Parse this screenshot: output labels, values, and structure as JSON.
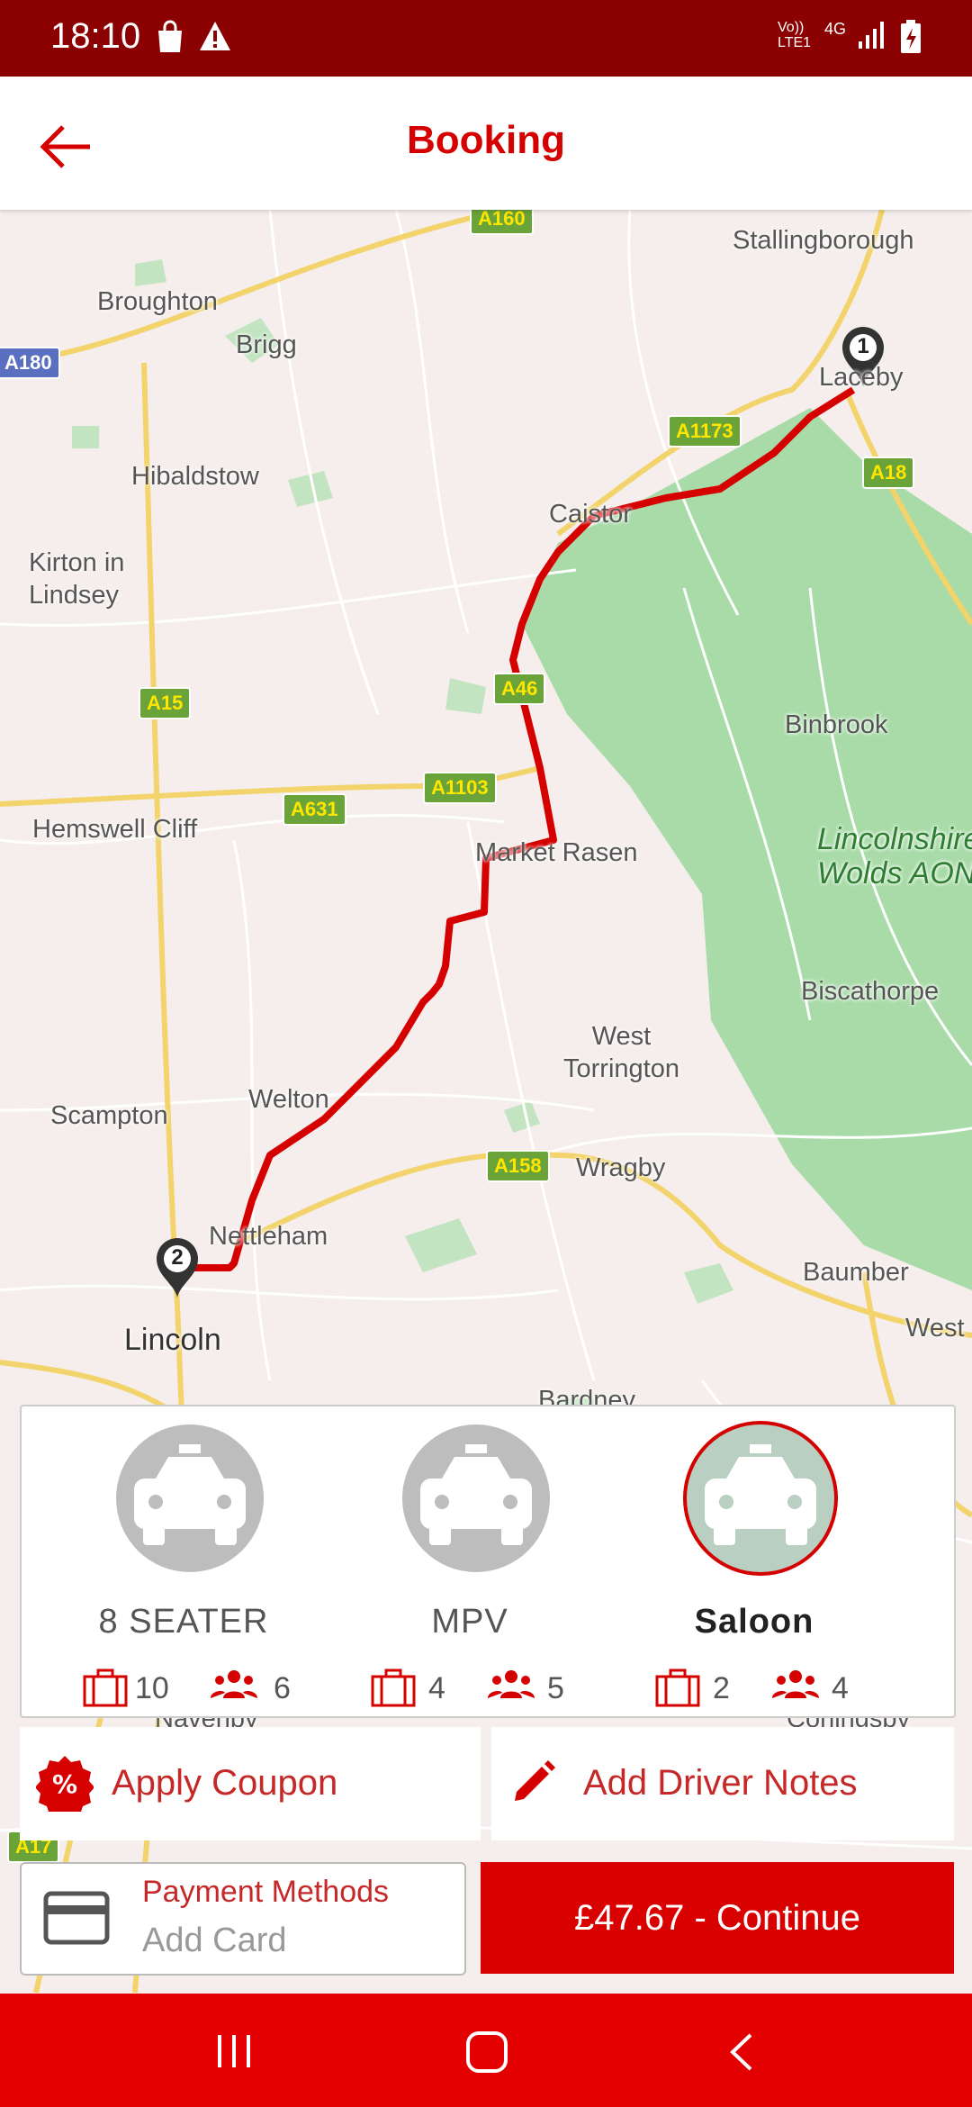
{
  "status_bar": {
    "time": "18:10",
    "left_icons": [
      "shopping-bag-icon",
      "warning-icon"
    ],
    "network_label_1": "Vo))",
    "network_label_2": "LTE1",
    "network_type": "4G",
    "right_icons": [
      "signal-icon",
      "battery-charging-icon"
    ]
  },
  "header": {
    "title": "Booking",
    "back_icon": "arrow-left-icon"
  },
  "map": {
    "places": {
      "stallingborough": "Stallingborough",
      "broughton": "Broughton",
      "brigg": "Brigg",
      "laceby": "Laceby",
      "hibaldstow": "Hibaldstow",
      "caistor": "Caistor",
      "kirton": "Kirton in\nLindsey",
      "binbrook": "Binbrook",
      "hemswell": "Hemswell Cliff",
      "market_rasen": "Market Rasen",
      "lincs_wolds": "Lincolnshire\nWolds AONB",
      "biscathorpe": "Biscathorpe",
      "west_torrington": "West\nTorrington",
      "scampton": "Scampton",
      "welton": "Welton",
      "wragby": "Wragby",
      "nettleham": "Nettleham",
      "baumber": "Baumber",
      "lincoln": "Lincoln",
      "west": "West",
      "bardney": "Bardney",
      "navenby": "Navenby",
      "coningsby": "Coningsby"
    },
    "roads": {
      "a180": "A180",
      "a160": "A160",
      "a1173": "A1173",
      "a18": "A18",
      "a46": "A46",
      "a15": "A15",
      "a1103": "A1103",
      "a631": "A631",
      "a158": "A158",
      "a17": "A17"
    },
    "markers": {
      "start": "1",
      "end": "2"
    },
    "route_color": "#d50000"
  },
  "vehicles": [
    {
      "name": "8 SEATER",
      "luggage": "10",
      "passengers": "6",
      "selected": false,
      "icon": "taxi-icon"
    },
    {
      "name": "MPV",
      "luggage": "4",
      "passengers": "5",
      "selected": false,
      "icon": "taxi-icon"
    },
    {
      "name": "Saloon",
      "luggage": "2",
      "passengers": "4",
      "selected": true,
      "icon": "taxi-icon"
    }
  ],
  "actions": {
    "coupon_label": "Apply Coupon",
    "coupon_icon": "percent-badge-icon",
    "notes_label": "Add Driver Notes",
    "notes_icon": "pencil-icon"
  },
  "payment": {
    "title": "Payment Methods",
    "value": "Add Card",
    "icon": "credit-card-icon"
  },
  "continue_label": "£47.67 - Continue",
  "colors": {
    "brand_red": "#d50000",
    "status_bar": "#8b0000",
    "nav_bar": "#e30000",
    "park_green": "#a8dba8"
  },
  "nav_bar": {
    "icons": [
      "recent-apps-icon",
      "home-icon",
      "back-icon"
    ]
  }
}
